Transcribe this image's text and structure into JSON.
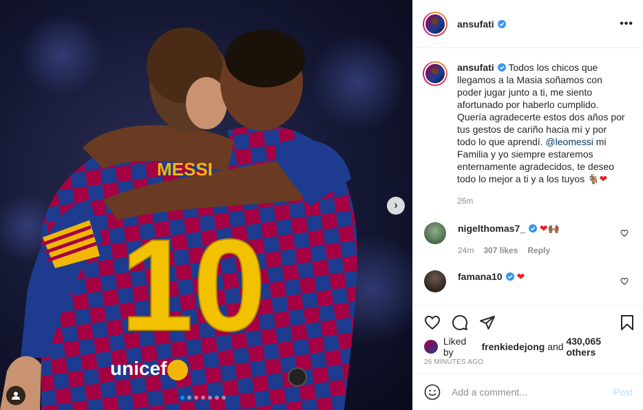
{
  "post": {
    "username": "ansufati",
    "more_label": "•••"
  },
  "caption": {
    "username": "ansufati",
    "text_before_mention": "Todos los chicos que llegamos a la Masia soñamos con poder jugar junto a ti, me siento afortunado por haberlo cumplido. Quería agradecerte estos dos años por tus gestos de cariño hacia mí y por todo lo que aprendí.",
    "mention": "@leomessi",
    "text_after_mention": "mi Familia y yo siempre estaremos enternamente agradecidos, te deseo todo lo mejor a ti y a los tuyos",
    "emoji": "🐐",
    "heart": "❤",
    "age": "26m"
  },
  "comments": [
    {
      "username": "nigelthomas7_",
      "text_emoji_heart": "❤",
      "text_emoji": "🙌🏾",
      "age": "24m",
      "likes": "307 likes",
      "reply_label": "Reply"
    },
    {
      "username": "famana10",
      "text_emoji_heart": "❤"
    }
  ],
  "likes": {
    "prefix": "Liked by",
    "user": "frenkiedejong",
    "and_text": "and",
    "others": "430,065 others"
  },
  "timestamp": "26 MINUTES AGO",
  "composer": {
    "placeholder": "Add a comment...",
    "post_label": "Post"
  },
  "media": {
    "jersey_name": "MESSI",
    "jersey_number": "10",
    "sponsor": "unicef",
    "carousel_total": 7,
    "carousel_active": 1
  },
  "colors": {
    "accent": "#0095f6",
    "barca_blue": "#1d3c8f",
    "barca_red": "#a50044",
    "heart": "#ed1c24"
  }
}
